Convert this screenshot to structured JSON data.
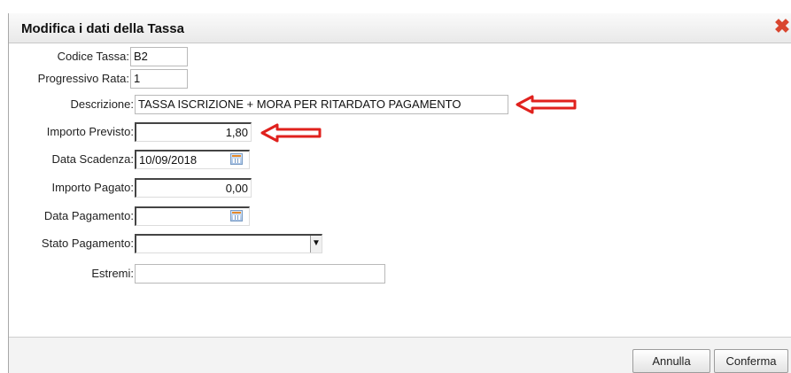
{
  "dialog": {
    "title": "Modifica i dati della Tassa",
    "close_glyph": "✖"
  },
  "form": {
    "codice_tassa_label": "Codice Tassa:",
    "codice_tassa_value": "B2",
    "progressivo_rata_label": "Progressivo Rata:",
    "progressivo_rata_value": "1",
    "descrizione_label": "Descrizione:",
    "descrizione_value": "TASSA ISCRIZIONE + MORA PER RITARDATO PAGAMENTO",
    "importo_previsto_label": "Importo Previsto:",
    "importo_previsto_value": "1,80",
    "data_scadenza_label": "Data Scadenza:",
    "data_scadenza_value": "10/09/2018",
    "importo_pagato_label": "Importo Pagato:",
    "importo_pagato_value": "0,00",
    "data_pagamento_label": "Data Pagamento:",
    "data_pagamento_value": "",
    "stato_pagamento_label": "Stato Pagamento:",
    "stato_pagamento_value": "",
    "estremi_label": "Estremi:",
    "estremi_value": ""
  },
  "buttons": {
    "annulla": "Annulla",
    "conferma": "Conferma"
  },
  "icons": {
    "close": "close-icon",
    "calendar": "calendar-icon",
    "dropdown": "chevron-down-icon",
    "annotation": "red-arrow-icon"
  },
  "colors": {
    "annotation_arrow": "#e0211d",
    "close": "#d9462f"
  }
}
